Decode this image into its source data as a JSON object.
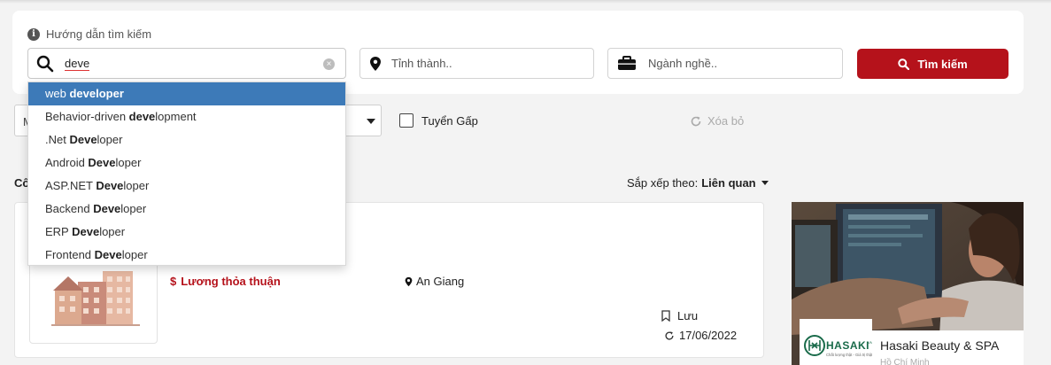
{
  "search": {
    "guide_label": "Hướng dẫn tìm kiếm",
    "keyword_value": "deve",
    "location_placeholder": "Tỉnh thành..",
    "industry_placeholder": "Ngành nghề..",
    "search_button": "Tìm kiếm"
  },
  "suggestions": [
    {
      "pre": "web ",
      "bold": "developer",
      "post": "",
      "active": true
    },
    {
      "pre": "Behavior-driven ",
      "bold": "deve",
      "post": "lopment",
      "active": false
    },
    {
      "pre": ".Net ",
      "bold": "Deve",
      "post": "loper",
      "active": false
    },
    {
      "pre": "Android ",
      "bold": "Deve",
      "post": "loper",
      "active": false
    },
    {
      "pre": "ASP.NET ",
      "bold": "Deve",
      "post": "loper",
      "active": false
    },
    {
      "pre": "Backend ",
      "bold": "Deve",
      "post": "loper",
      "active": false
    },
    {
      "pre": "ERP ",
      "bold": "Deve",
      "post": "loper",
      "active": false
    },
    {
      "pre": "Frontend ",
      "bold": "Deve",
      "post": "loper",
      "active": false
    }
  ],
  "filters": {
    "select_value": "M",
    "urgent_label": "Tuyển Gấp",
    "clear_label": "Xóa bỏ"
  },
  "results": {
    "count_label": "Cô",
    "sort_label": "Sắp xếp theo:",
    "sort_value": "Liên quan"
  },
  "job": {
    "salary": "Lương thỏa thuận",
    "location": "An Giang",
    "save_label": "Lưu",
    "date": "17/06/2022"
  },
  "ad": {
    "company": "Hasaki Beauty & SPA",
    "city": "Hồ Chí Minh",
    "logo_text": "HASAKI",
    "logo_sub": "Chất lượng thật - Giá trị thật"
  },
  "colors": {
    "brand_red": "#b5121b",
    "highlight_blue": "#3d7ab8"
  }
}
